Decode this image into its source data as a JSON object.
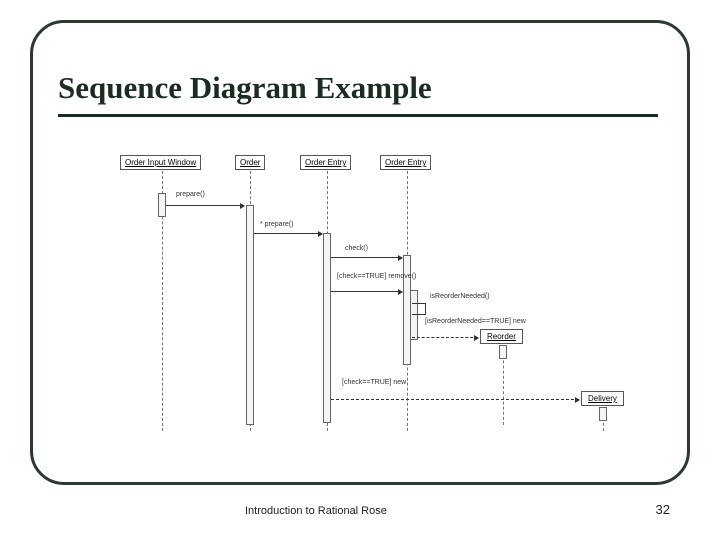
{
  "title": "Sequence Diagram Example",
  "footer": "Introduction to Rational Rose",
  "page": "32",
  "objects": {
    "o1": "Order Input Window",
    "o2": "Order",
    "o3": "Order Entry",
    "o4": "Order Entry"
  },
  "created": {
    "reorder": "Reorder",
    "delivery": "Delivery"
  },
  "messages": {
    "m1": "prepare()",
    "m2": "* prepare()",
    "m3": "check()",
    "m4": "[check==TRUE]\nremove()",
    "m5": "isReorderNeeded()",
    "m6": "[isReorderNeeded==TRUE]\nnew",
    "m7": "[check==TRUE]\nnew"
  }
}
